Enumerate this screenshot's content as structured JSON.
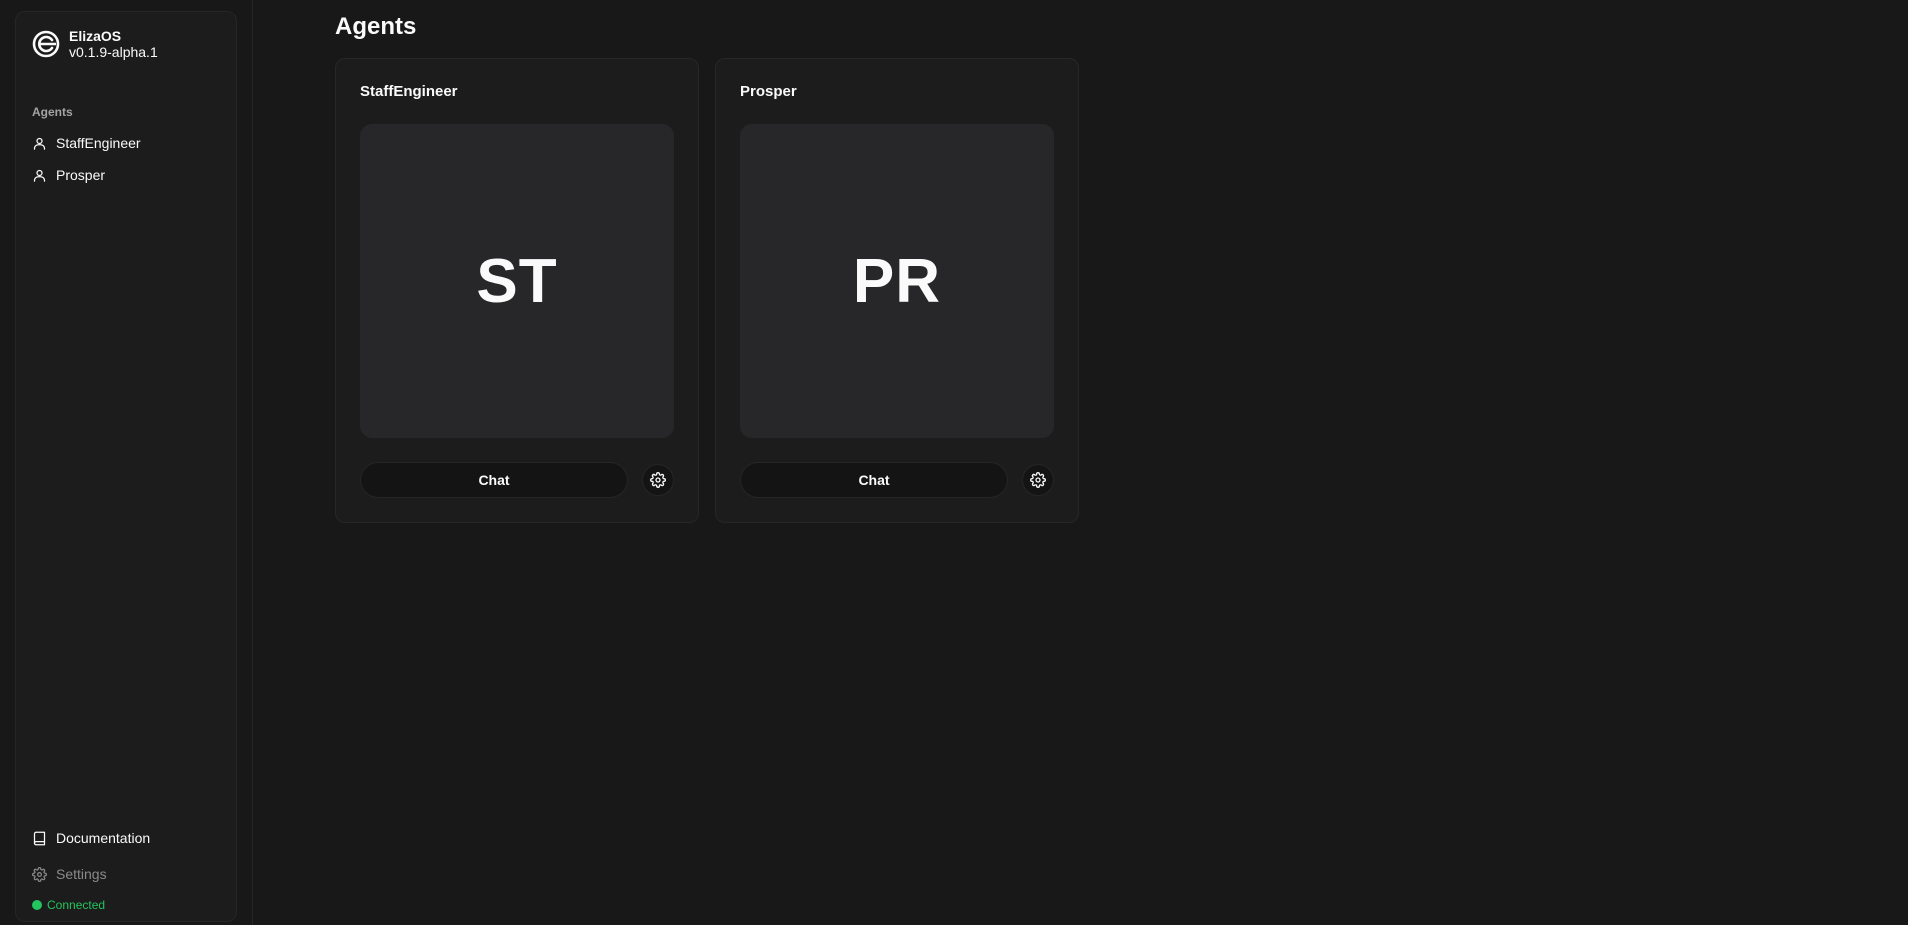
{
  "brand": {
    "name": "ElizaOS",
    "version": "v0.1.9-alpha.1",
    "logo_icon": "eliza-logo-icon"
  },
  "sidebar": {
    "group_label": "Agents",
    "items": [
      {
        "label": "StaffEngineer",
        "icon": "user-icon"
      },
      {
        "label": "Prosper",
        "icon": "user-icon"
      }
    ],
    "footer_items": [
      {
        "label": "Documentation",
        "icon": "book-icon"
      },
      {
        "label": "Settings",
        "icon": "gear-icon"
      }
    ],
    "status": "Connected"
  },
  "main": {
    "title": "Agents",
    "agents": [
      {
        "name": "StaffEngineer",
        "initials": "ST",
        "chat_label": "Chat",
        "settings_icon": "gear-icon"
      },
      {
        "name": "Prosper",
        "initials": "PR",
        "chat_label": "Chat",
        "settings_icon": "gear-icon"
      }
    ]
  },
  "colors": {
    "background": "#181818",
    "sidebar": "#1c1c1c",
    "card": "#1c1c1c",
    "avatar": "#27272a",
    "status": "#22c55e",
    "text": "#fafafa"
  }
}
